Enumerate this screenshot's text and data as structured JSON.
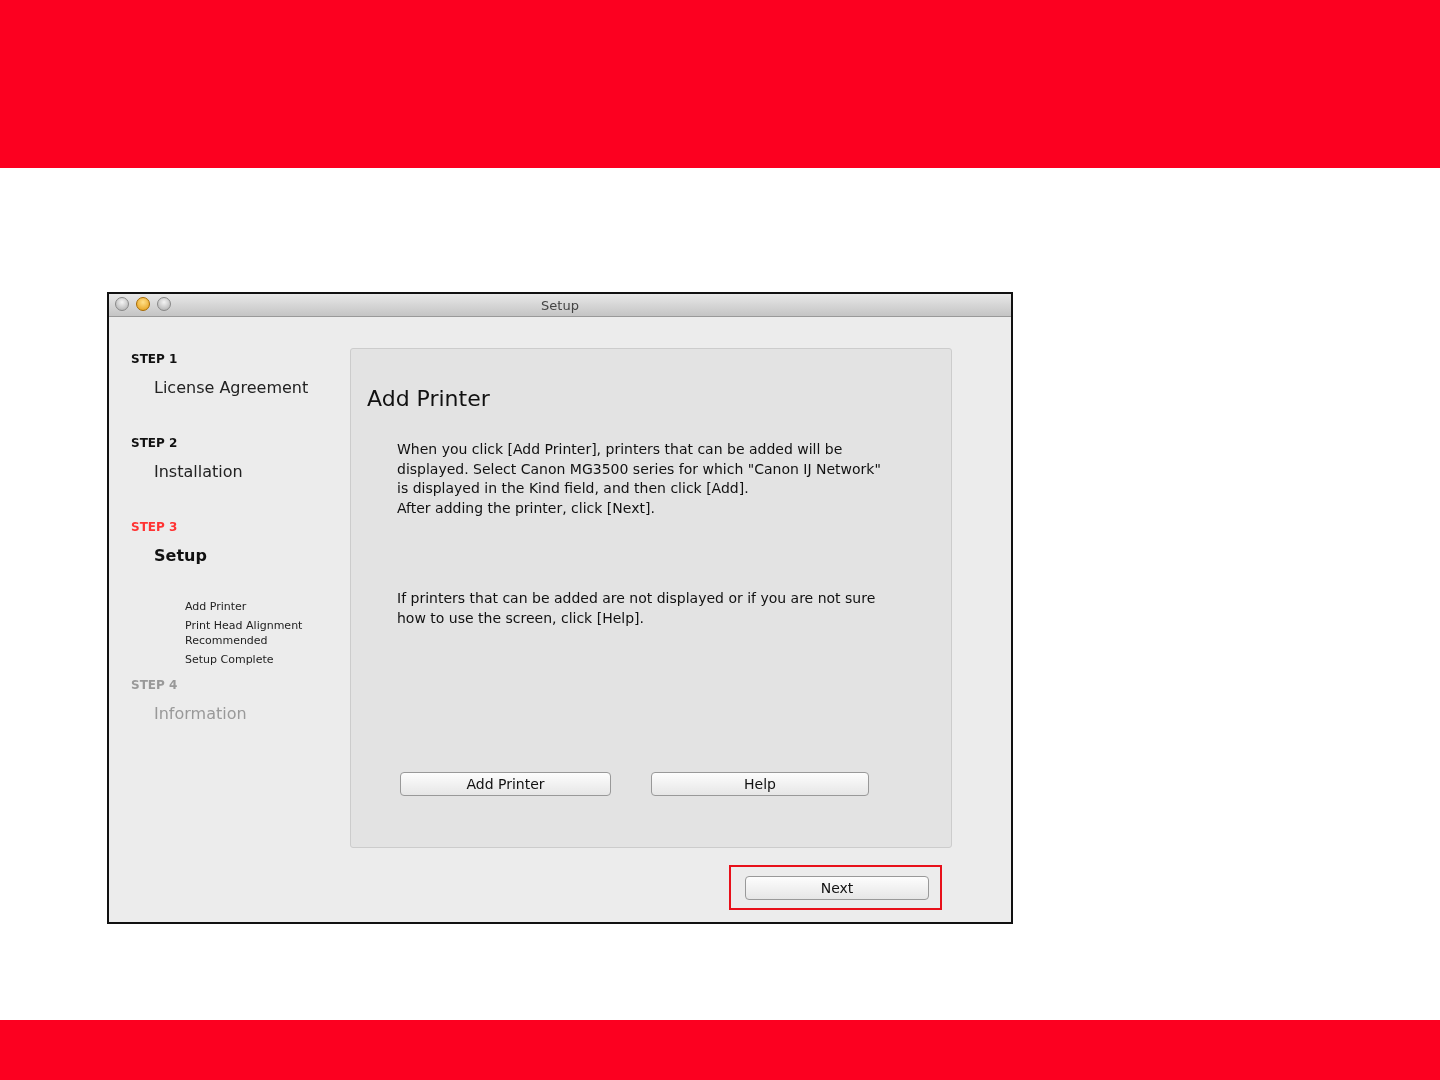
{
  "window": {
    "title": "Setup"
  },
  "steps": [
    {
      "label": "STEP 1",
      "title": "License Agreement",
      "selected": false,
      "disabled": false
    },
    {
      "label": "STEP 2",
      "title": "Installation",
      "selected": false,
      "disabled": false
    },
    {
      "label": "STEP 3",
      "title": "Setup",
      "selected": true,
      "disabled": false,
      "children": [
        {
          "text": "Add Printer"
        },
        {
          "text": "Print Head Alignment Recommended"
        },
        {
          "text": "Setup Complete"
        }
      ]
    },
    {
      "label": "STEP 4",
      "title": "Information",
      "selected": false,
      "disabled": true
    }
  ],
  "panel": {
    "heading": "Add Printer",
    "paragraphs": [
      "When you click [Add Printer], printers that can be added will be displayed. Select Canon MG3500 series for which \"Canon IJ Network\" is displayed in the Kind field, and then click [Add].\nAfter adding the printer, click [Next].",
      "If printers that can be added are not displayed or if you are not sure how to use the screen, click [Help]."
    ],
    "buttons": [
      "Add Printer",
      "Help"
    ]
  },
  "next_button": {
    "label": "Next",
    "highlighted": true
  }
}
